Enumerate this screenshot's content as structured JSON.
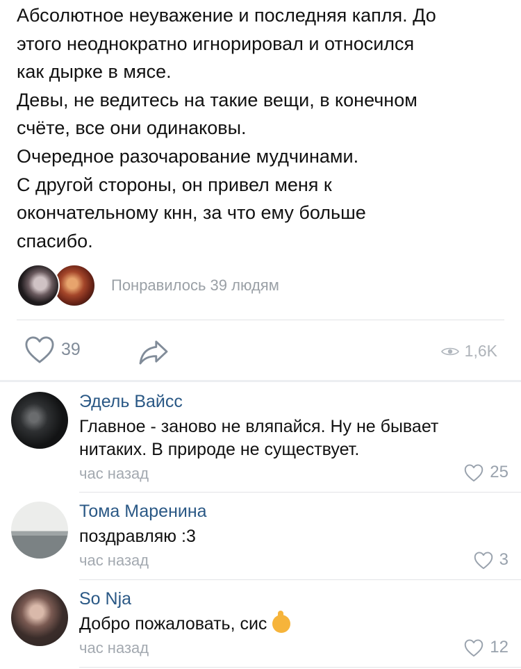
{
  "post": {
    "text": "Абсолютное неуважение и последняя капля. До\nэтого неоднократно игнорировал и относился\nкак дырке в мясе.\nДевы, не ведитесь на такие вещи, в конечном\nсчёте, все они одинаковы.\nОчередное разочарование мудчинами.\nС другой стороны, он привел меня к\nокончательному кнн, за что ему больше\nспасибо.",
    "likers_text": "Понравилось 39 людям",
    "like_count": "39",
    "views": "1,6K"
  },
  "comments": [
    {
      "author": "Эдель Вайсс",
      "text": "Главное - заново не вляпайся. Ну не бывает нитаких. В природе не существует.",
      "time": "час назад",
      "likes": "25"
    },
    {
      "author": "Тома Маренина",
      "text": "поздравляю :3",
      "time": "час назад",
      "likes": "3"
    },
    {
      "author": "So Nja",
      "text": "Добро пожаловать, сис",
      "time": "час назад",
      "likes": "12"
    }
  ],
  "icons": {
    "like": "heart-outline-icon",
    "share": "share-arrow-icon",
    "views": "eye-icon",
    "emoji": "raising-hand-emoji"
  },
  "colors": {
    "author": "#2a5885",
    "muted": "#99a2ad",
    "divider": "#e2e3e6"
  }
}
